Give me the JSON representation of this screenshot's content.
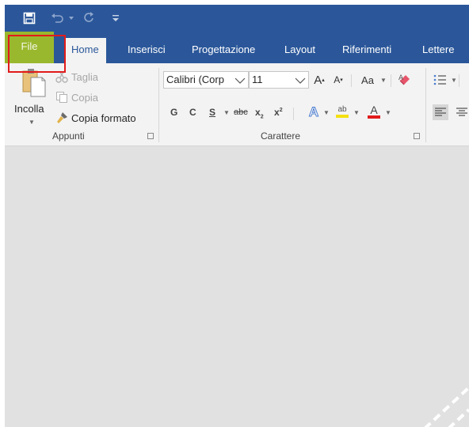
{
  "quick_access": {
    "icons": [
      "save-icon",
      "undo-icon",
      "redo-icon",
      "customize-toolbar-icon"
    ]
  },
  "tabs": {
    "file": "File",
    "home": "Home",
    "insert": "Inserisci",
    "design": "Progettazione",
    "layout": "Layout",
    "references": "Riferimenti",
    "mailings": "Lettere"
  },
  "clipboard": {
    "paste": "Incolla",
    "cut": "Taglia",
    "copy": "Copia",
    "format_painter": "Copia formato",
    "group_label": "Appunti"
  },
  "font": {
    "font_name": "Calibri (Corp",
    "font_size": "11",
    "change_case": "Aa",
    "bold": "G",
    "italic": "C",
    "underline": "S",
    "strikethrough": "abc",
    "subscript": "x",
    "subscript_mark": "2",
    "superscript": "x",
    "superscript_mark": "2",
    "highlight_text": "ab",
    "font_color_letter": "A",
    "effects_letter": "A",
    "grow_letter": "A",
    "shrink_letter": "A",
    "group_label": "Carattere"
  },
  "colors": {
    "title_bar": "#2b579a",
    "file_tab_highlight": "#9ab82e",
    "callout_box": "#e21b1b",
    "highlight_yellow": "#f4e012",
    "font_color_red": "#e21b1b",
    "document_area": "#e1e1e1"
  }
}
